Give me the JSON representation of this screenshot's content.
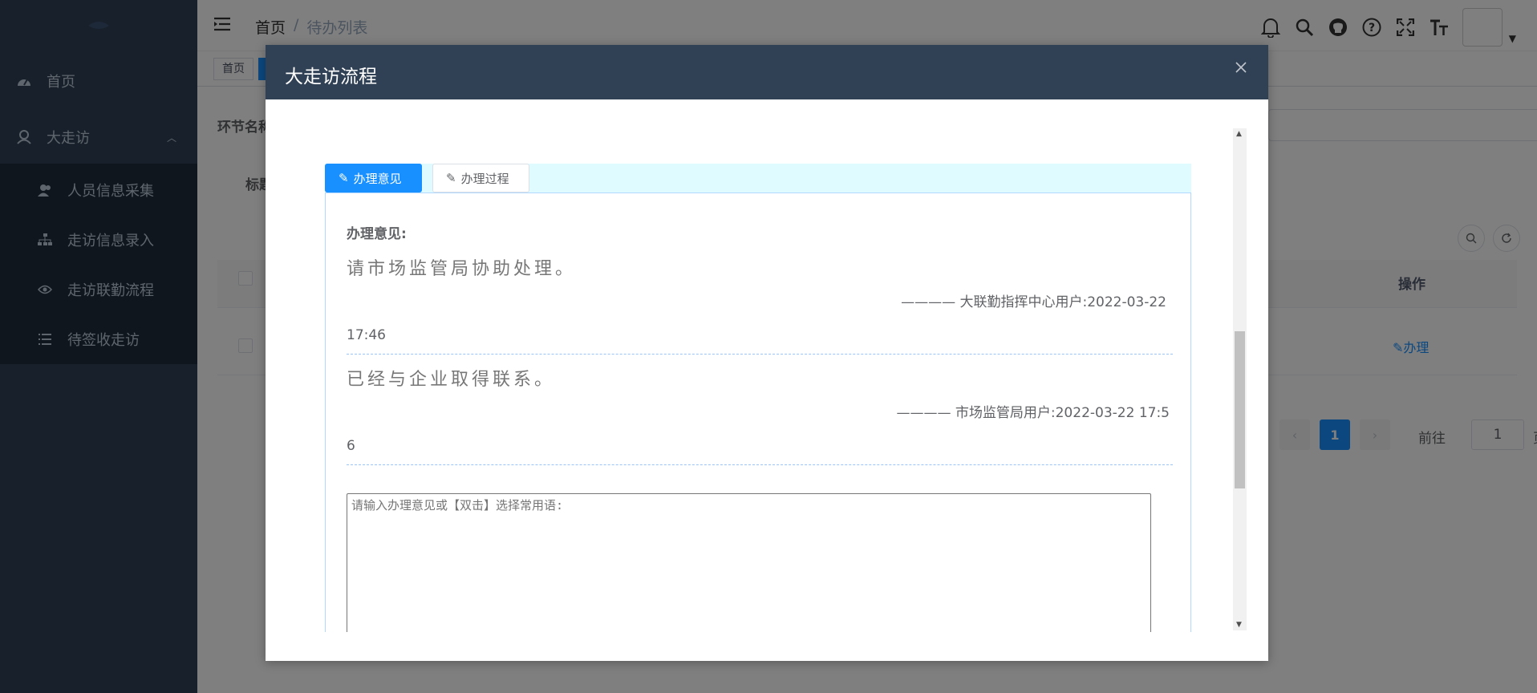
{
  "sidebar": {
    "items": [
      {
        "label": "首页",
        "icon": "dashboard-icon"
      },
      {
        "label": "大走访",
        "icon": "people-icon"
      }
    ],
    "submenu": [
      {
        "label": "人员信息采集",
        "icon": "user-icon"
      },
      {
        "label": "走访信息录入",
        "icon": "tree-icon"
      },
      {
        "label": "走访联勤流程",
        "icon": "eye-icon"
      },
      {
        "label": "待签收走访",
        "icon": "list-icon"
      }
    ]
  },
  "header": {
    "breadcrumb": [
      "首页",
      "待办列表"
    ],
    "icons": [
      "bell-icon",
      "search-icon",
      "github-icon",
      "question-icon",
      "fullscreen-icon",
      "font-size-icon"
    ]
  },
  "tags": {
    "home": "首页"
  },
  "content": {
    "label_node": "环节名称",
    "label_title": "标题",
    "col_operation": "操作",
    "row_action": "办理",
    "pager": {
      "current": "1",
      "goto_label": "前往",
      "goto_value": "1",
      "page_suffix": "页"
    }
  },
  "dialog": {
    "title": "大走访流程",
    "tabs": [
      {
        "label": "办理意见"
      },
      {
        "label": "办理过程"
      }
    ],
    "opinion_title": "办理意见:",
    "opinions": [
      {
        "text": "请市场监管局协助处理。",
        "sign": "———— 大联勤指挥中心用户:2022-03-22",
        "sign_wrap": "17:46"
      },
      {
        "text": "已经与企业取得联系。",
        "sign": "———— 市场监管局用户:2022-03-22 17:5",
        "sign_wrap": "6"
      }
    ],
    "textarea_placeholder": "请输入办理意见或【双击】选择常用语:"
  },
  "colors": {
    "sidebar_bg": "#304156",
    "submenu_bg": "#1f2d3d",
    "accent": "#1890ff",
    "dialog_header_bg": "#304156"
  }
}
